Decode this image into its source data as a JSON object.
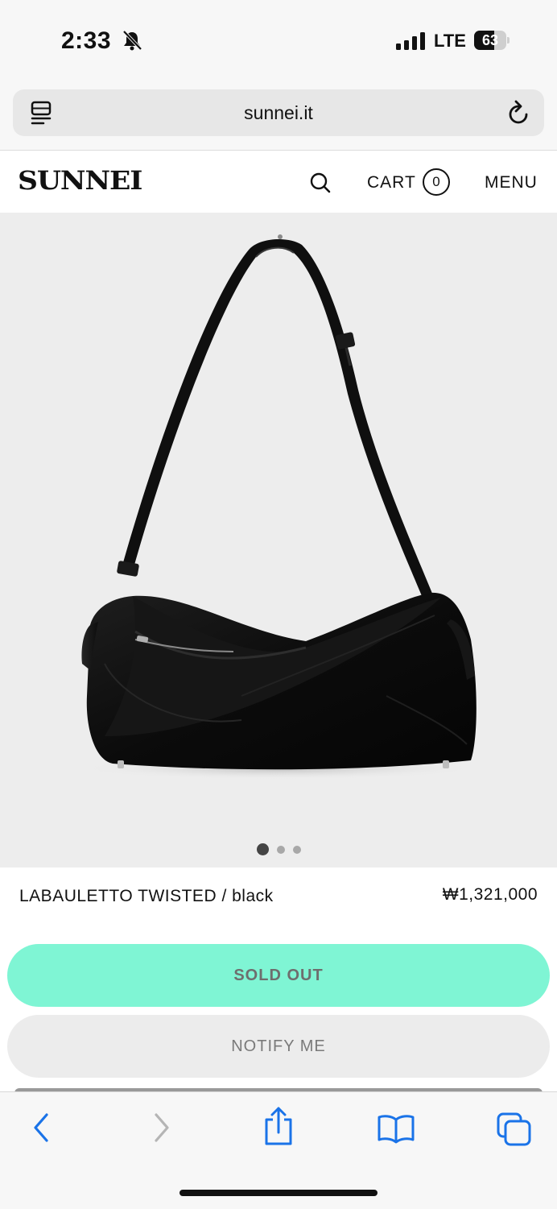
{
  "status_bar": {
    "time": "2:33",
    "network": "LTE",
    "battery": "63",
    "battery_level": 0.63
  },
  "browser": {
    "url": "sunnei.it"
  },
  "header": {
    "logo": "SUNNEI",
    "cart_label": "CART",
    "cart_count": "0",
    "menu_label": "MENU"
  },
  "gallery": {
    "image": "black-shoulder-bag",
    "slides": 3,
    "active_slide": 1
  },
  "product": {
    "name": "LABAULETTO TWISTED / black",
    "price": "₩1,321,000",
    "sold_out_label": "SOLD OUT",
    "notify_label": "NOTIFY ME"
  },
  "colors": {
    "accent": "#7ff5d4",
    "link_blue": "#1a73e8",
    "hero_bg": "#ededed"
  },
  "toolbar": {
    "icons": [
      "back-icon",
      "forward-icon",
      "share-icon",
      "bookmarks-icon",
      "tabs-icon"
    ]
  }
}
